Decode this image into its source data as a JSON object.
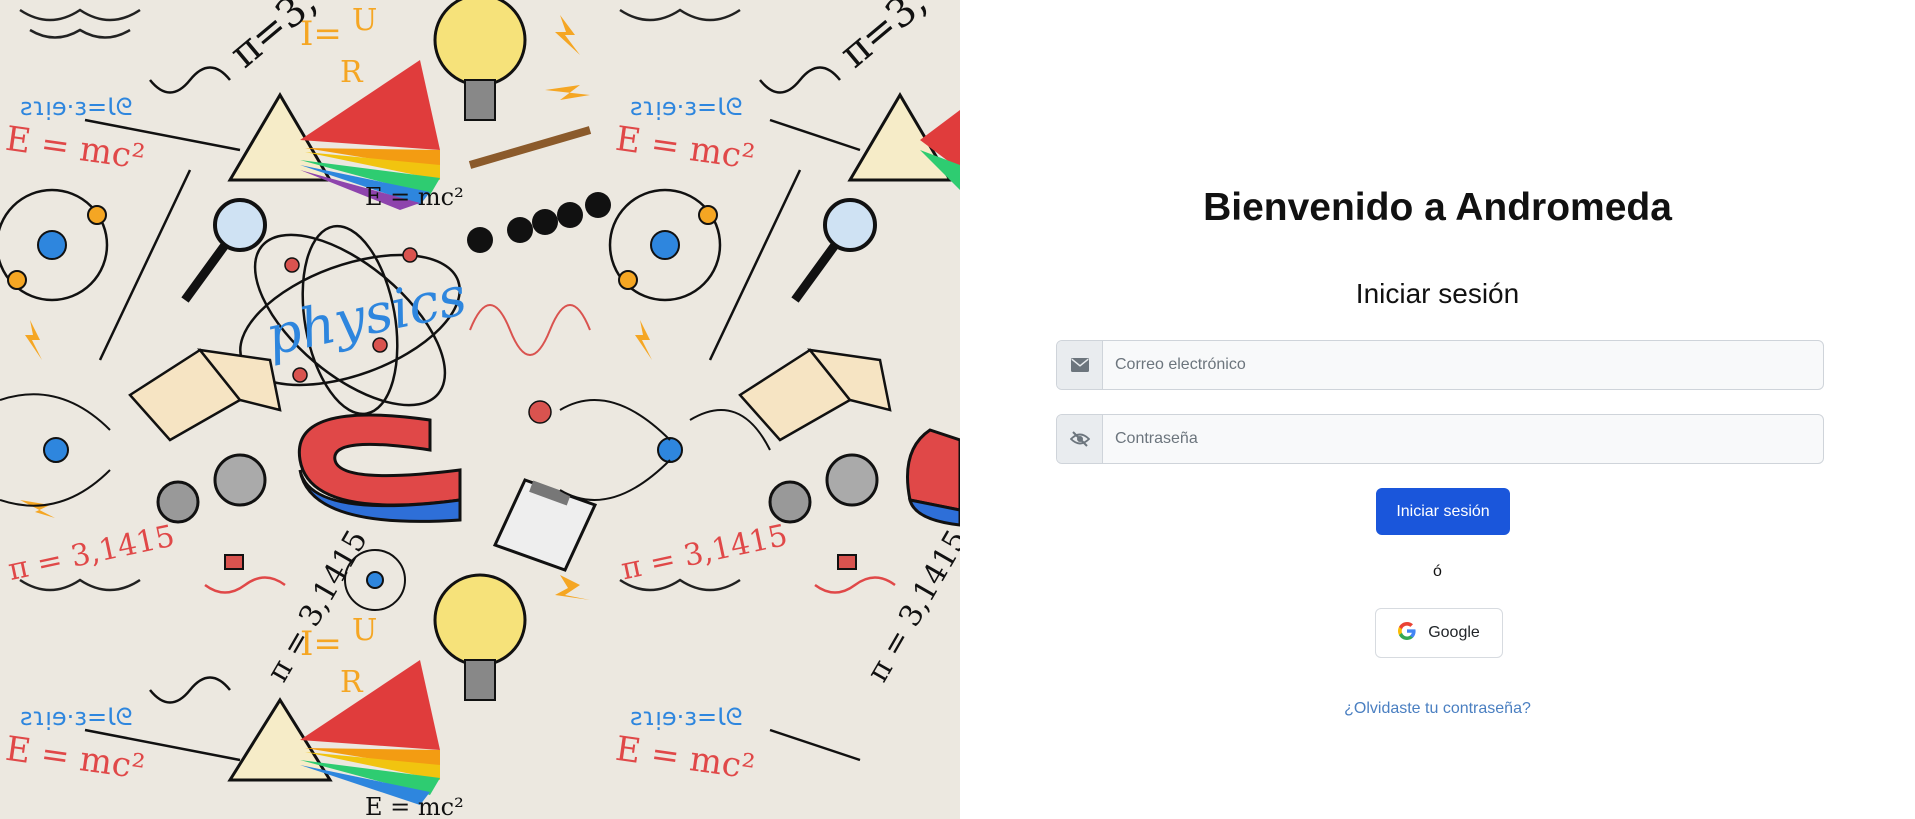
{
  "hero": {
    "background_color": "#ece8e0",
    "doodle_texts": {
      "physics": "physics",
      "emc2": "E = mc²",
      "emc2_small": "E = mc²",
      "pi": "π = 3,1415",
      "pi_rotated": "π = 3,1415",
      "ohm_i": "I=",
      "ohm_u": "U",
      "ohm_r": "R",
      "mirror_pi": "ƨɿᴉɘ·ɜ=Ɩᘓ"
    }
  },
  "login": {
    "title": "Bienvenido a Andromeda",
    "subtitle": "Iniciar sesión",
    "email_placeholder": "Correo electrónico",
    "email_value": "",
    "email_icon": "envelope-icon",
    "password_placeholder": "Contraseña",
    "password_value": "",
    "password_icon": "eye-slash-icon",
    "submit_label": "Iniciar sesión",
    "separator": "ó",
    "google_label": "Google",
    "google_icon": "google-icon",
    "forgot_link": "¿Olvidaste tu contraseña?"
  },
  "colors": {
    "primary": "#1a56db",
    "link": "#4a7fc1",
    "field_bg": "#f8f9fa",
    "addon_bg": "#e9ecef"
  }
}
